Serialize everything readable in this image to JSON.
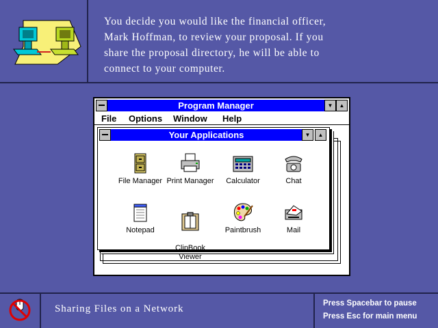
{
  "narration": "You decide you would like the financial officer,\nMark Hoffman, to review your proposal.  If you\nshare the proposal directory, he will be able to\nconnect to your computer.",
  "program_manager": {
    "title": "Program Manager",
    "menus": [
      "File",
      "Options",
      "Window",
      "Help"
    ]
  },
  "group": {
    "title": "Your Applications",
    "apps": [
      {
        "label": "File Manager",
        "icon": "file-cabinet-icon"
      },
      {
        "label": "Print Manager",
        "icon": "printer-icon"
      },
      {
        "label": "Calculator",
        "icon": "calculator-icon"
      },
      {
        "label": "Chat",
        "icon": "telephone-icon"
      },
      {
        "label": "Notepad",
        "icon": "notepad-icon"
      },
      {
        "label": "ClipBook\nViewer",
        "icon": "clipbook-icon"
      },
      {
        "label": "Paintbrush",
        "icon": "palette-icon"
      },
      {
        "label": "Mail",
        "icon": "mail-icon"
      }
    ]
  },
  "footer": {
    "topic": "Sharing Files on a Network",
    "help_pause": "Press Spacebar to pause",
    "help_menu": "Press Esc for main menu"
  },
  "colors": {
    "background": "#5558a6",
    "titlebar": "#0000ff",
    "divider": "#20224a"
  }
}
